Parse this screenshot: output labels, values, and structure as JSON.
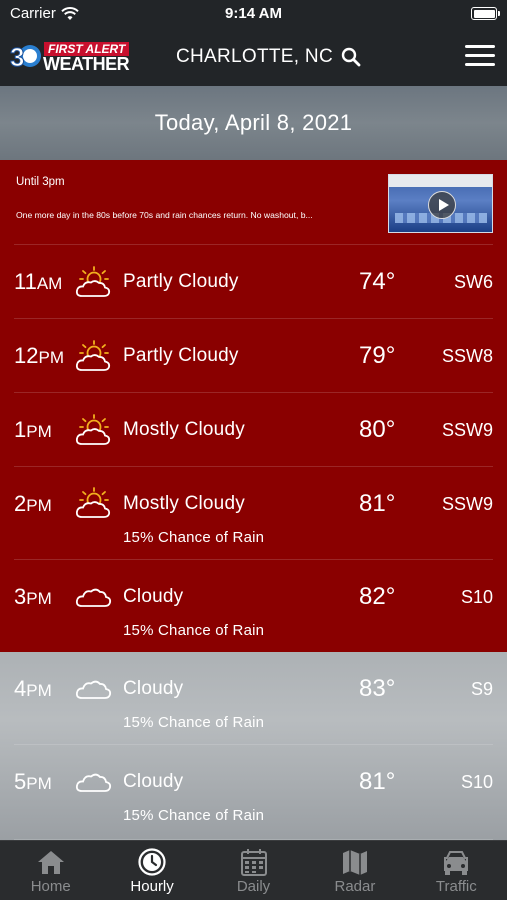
{
  "status_bar": {
    "carrier": "Carrier",
    "time": "9:14 AM"
  },
  "header": {
    "logo_number": "3",
    "logo_top": "FIRST ALERT",
    "logo_bottom": "WEATHER",
    "location": "CHARLOTTE, NC",
    "search_icon": "search-icon",
    "menu_icon": "hamburger-menu-icon"
  },
  "date_title": "Today, April 8, 2021",
  "summary": {
    "until": "Until 3pm",
    "text": "One more day in the 80s before 70s and rain chances return.  No washout, b..."
  },
  "hours": [
    {
      "time": "11",
      "ampm": "AM",
      "icon": "partly-cloudy-icon",
      "condition": "Partly Cloudy",
      "temp": "74°",
      "wind": "SW6",
      "rain": ""
    },
    {
      "time": "12",
      "ampm": "PM",
      "icon": "partly-cloudy-icon",
      "condition": "Partly Cloudy",
      "temp": "79°",
      "wind": "SSW8",
      "rain": ""
    },
    {
      "time": "1",
      "ampm": "PM",
      "icon": "mostly-cloudy-icon",
      "condition": "Mostly Cloudy",
      "temp": "80°",
      "wind": "SSW9",
      "rain": ""
    },
    {
      "time": "2",
      "ampm": "PM",
      "icon": "mostly-cloudy-icon",
      "condition": "Mostly Cloudy",
      "temp": "81°",
      "wind": "SSW9",
      "rain": "15% Chance of Rain"
    },
    {
      "time": "3",
      "ampm": "PM",
      "icon": "cloudy-icon",
      "condition": "Cloudy",
      "temp": "82°",
      "wind": "S10",
      "rain": "15% Chance of Rain"
    },
    {
      "time": "4",
      "ampm": "PM",
      "icon": "cloudy-icon",
      "condition": "Cloudy",
      "temp": "83°",
      "wind": "S9",
      "rain": "15% Chance of Rain"
    },
    {
      "time": "5",
      "ampm": "PM",
      "icon": "cloudy-icon",
      "condition": "Cloudy",
      "temp": "81°",
      "wind": "S10",
      "rain": "15% Chance of Rain"
    }
  ],
  "tabs": [
    {
      "label": "Home",
      "icon": "home-icon",
      "active": false
    },
    {
      "label": "Hourly",
      "icon": "clock-icon",
      "active": true
    },
    {
      "label": "Daily",
      "icon": "calendar-icon",
      "active": false
    },
    {
      "label": "Radar",
      "icon": "map-icon",
      "active": false
    },
    {
      "label": "Traffic",
      "icon": "car-icon",
      "active": false
    }
  ],
  "colors": {
    "alert_red": "#8a0000",
    "header_bg": "#222528",
    "tab_bg": "#2a2c2e",
    "tab_inactive": "#8a8c8e",
    "logo_red": "#c8102e"
  }
}
